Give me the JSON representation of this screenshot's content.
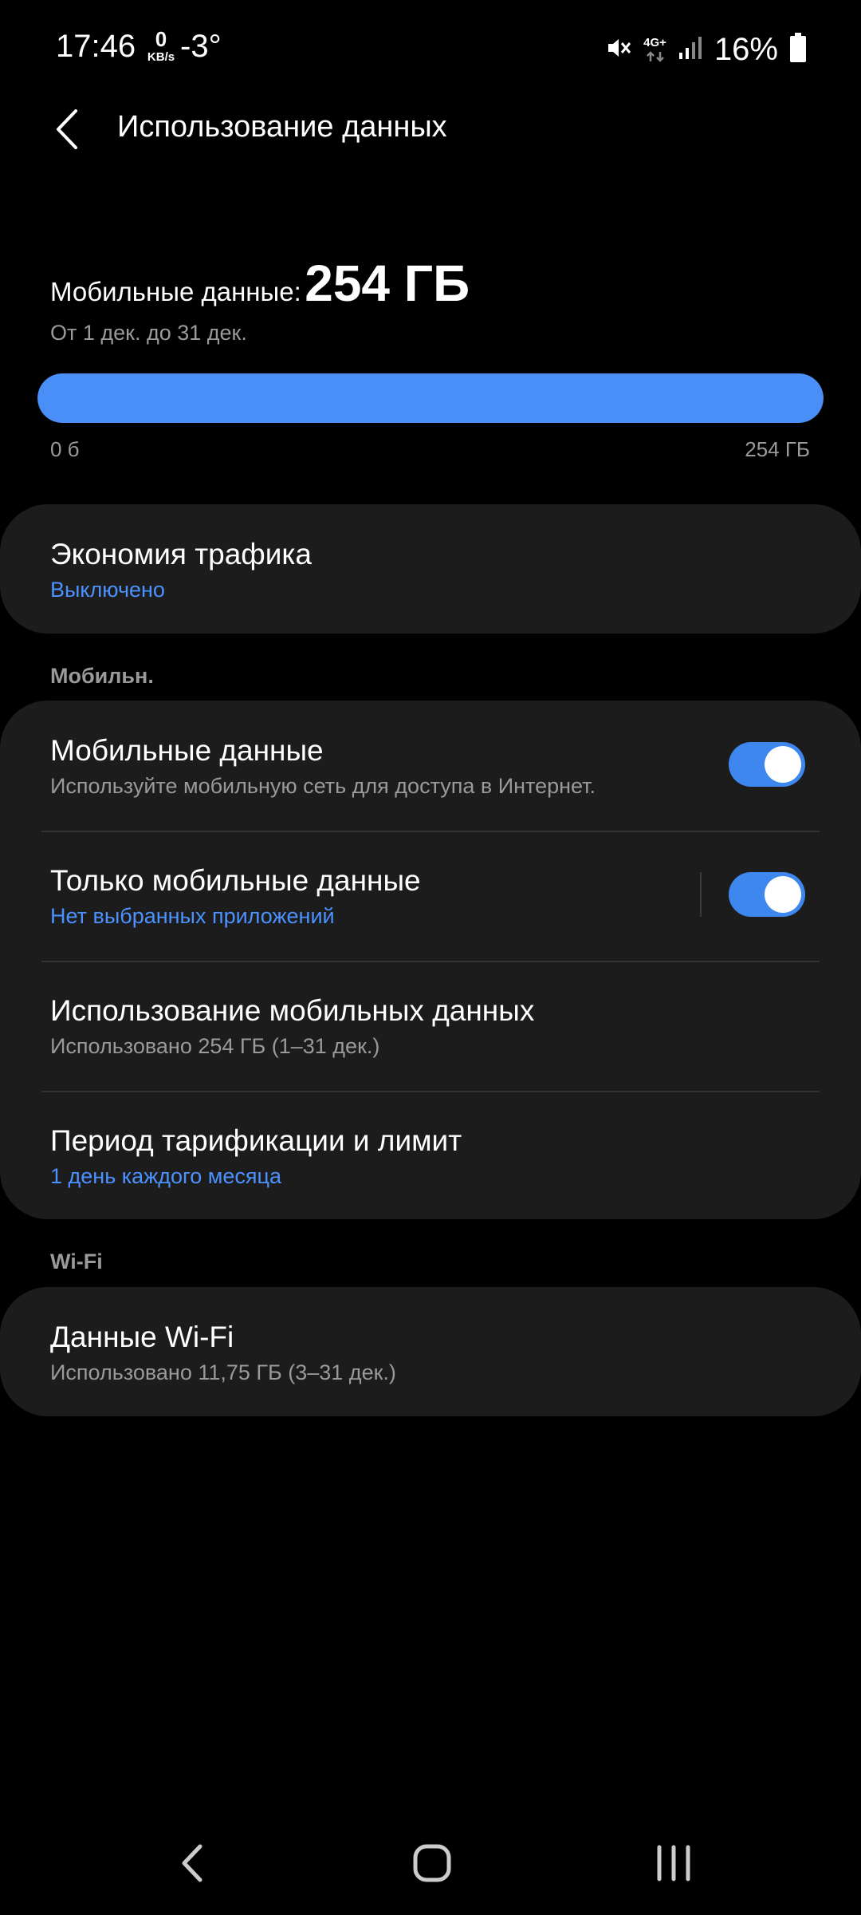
{
  "status_bar": {
    "time": "17:46",
    "net_speed_value": "0",
    "net_speed_unit": "KB/s",
    "temperature": "-3°",
    "network_type": "4G+",
    "battery_percent": "16%"
  },
  "header": {
    "title": "Использование данных"
  },
  "summary": {
    "label": "Мобильные данные:",
    "value": "254 ГБ",
    "period": "От 1 дек. до 31 дек.",
    "bar_min": "0 б",
    "bar_max": "254 ГБ",
    "bar_fill_fraction": 1.0
  },
  "saver": {
    "title": "Экономия трафика",
    "status": "Выключено"
  },
  "mobile_section": {
    "label": "Мобильн.",
    "items": [
      {
        "title": "Мобильные данные",
        "subtitle": "Используйте мобильную сеть для доступа в Интернет.",
        "toggle_on": true
      },
      {
        "title": "Только мобильные данные",
        "subtitle": "Нет выбранных приложений",
        "toggle_on": true
      },
      {
        "title": "Использование мобильных данных",
        "subtitle": "Использовано 254 ГБ (1–31 дек.)"
      },
      {
        "title": "Период тарификации и лимит",
        "subtitle": "1 день каждого месяца"
      }
    ]
  },
  "wifi_section": {
    "label": "Wi-Fi",
    "items": [
      {
        "title": "Данные Wi-Fi",
        "subtitle": "Использовано 11,75 ГБ (3–31 дек.)"
      }
    ]
  },
  "colors": {
    "accent_blue": "#4a8ff7",
    "link_blue": "#4b92ff",
    "card_bg": "#1c1c1c",
    "toggle_on": "#3d87ef"
  }
}
